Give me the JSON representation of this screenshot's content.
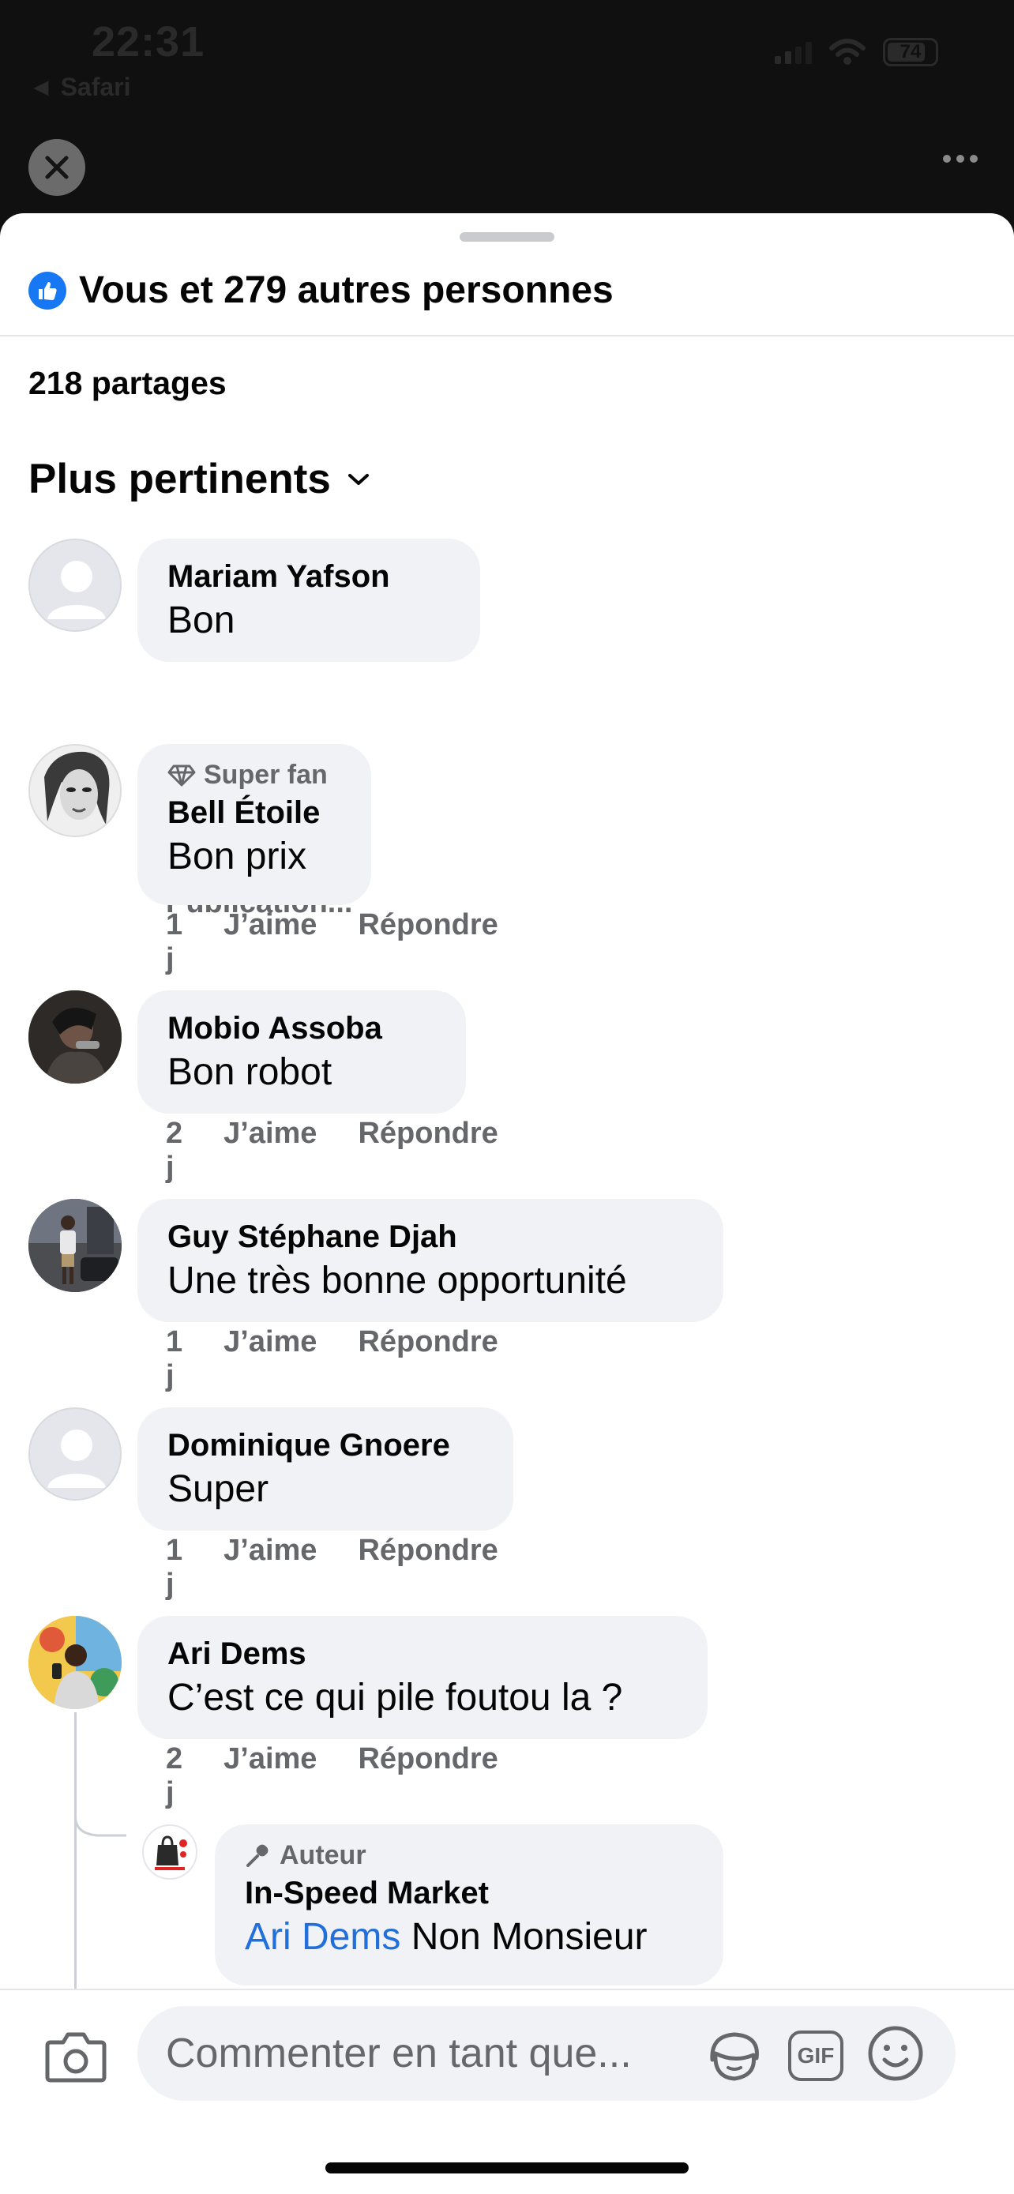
{
  "status": {
    "time": "22:31",
    "back_app": "◄ Safari",
    "battery": "74"
  },
  "header": {
    "reactions_text": "Vous et 279 autres personnes",
    "shares_text": "218 partages",
    "sort_label": "Plus pertinents"
  },
  "comments": [
    {
      "author": "Mariam Yafson",
      "text": "Bon",
      "status": "Publication..."
    },
    {
      "badge": "Super fan",
      "author": "Bell Étoile",
      "text": "Bon prix",
      "time": "1 j",
      "like": "J’aime",
      "reply": "Répondre"
    },
    {
      "author": "Mobio Assoba",
      "text": "Bon robot",
      "time": "2 j",
      "like": "J’aime",
      "reply": "Répondre"
    },
    {
      "author": "Guy Stéphane Djah",
      "text": "Une très bonne opportunité",
      "time": "1 j",
      "like": "J’aime",
      "reply": "Répondre"
    },
    {
      "author": "Dominique Gnoere",
      "text": "Super",
      "time": "1 j",
      "like": "J’aime",
      "reply": "Répondre"
    },
    {
      "author": "Ari Dems",
      "text": "C’est ce qui pile foutou la ?",
      "time": "2 j",
      "like": "J’aime",
      "reply": "Répondre"
    }
  ],
  "reply": {
    "badge": "Auteur",
    "author": "In-Speed Market",
    "mention": "Ari Dems",
    "text": "Non Monsieur"
  },
  "composer": {
    "placeholder": "Commenter en tant que...",
    "gif_label": "GIF"
  },
  "colors": {
    "brand_blue": "#1877f2",
    "mention_blue": "#216fdb",
    "bubble_gray": "#f0f2f5",
    "meta_gray": "#65676b"
  }
}
